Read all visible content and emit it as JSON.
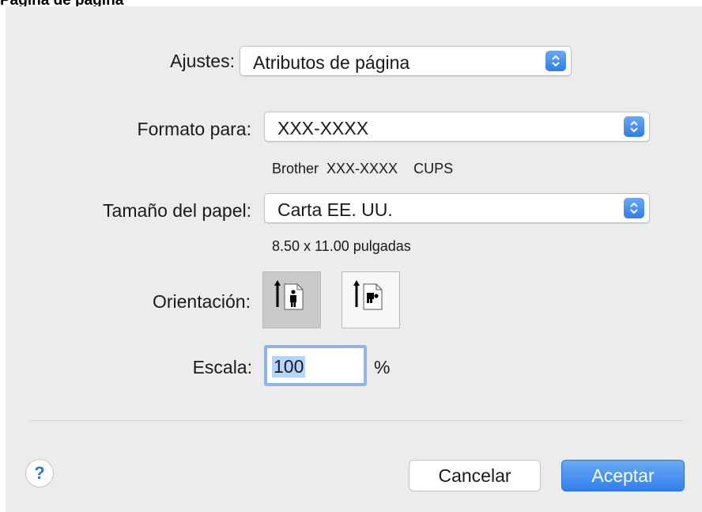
{
  "caption": "Página de página",
  "settings": {
    "label": "Ajustes:",
    "value": "Atributos de página"
  },
  "format_for": {
    "label": "Formato para:",
    "value": "XXX-XXXX",
    "info": "Brother  XXX-XXXX    CUPS"
  },
  "paper_size": {
    "label": "Tamaño del papel:",
    "value": "Carta EE. UU.",
    "info": "8.50 x 11.00 pulgadas"
  },
  "orientation": {
    "label": "Orientación:",
    "selected": "portrait"
  },
  "scale": {
    "label": "Escala:",
    "value": "100",
    "unit": "%"
  },
  "help": {
    "symbol": "?"
  },
  "buttons": {
    "cancel": "Cancelar",
    "ok": "Aceptar"
  },
  "colors": {
    "accent": "#2f7fee",
    "dialog_bg": "#ececec",
    "focus_ring": "#8fb4ea",
    "selection": "#b5d3ff"
  }
}
